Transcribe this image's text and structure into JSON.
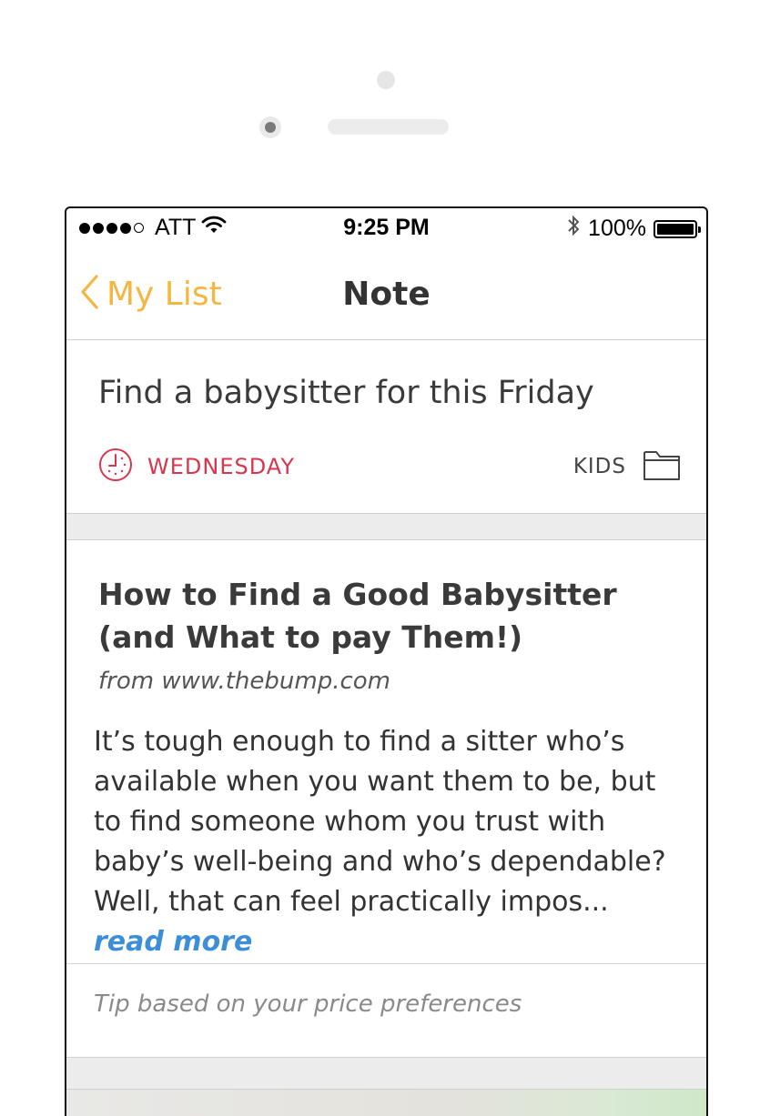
{
  "status_bar": {
    "carrier": "ATT",
    "time": "9:25 PM",
    "battery_percent": "100%",
    "signal_bars_filled": 4,
    "signal_bars_total": 5
  },
  "nav": {
    "back_label": "My List",
    "title": "Note"
  },
  "task": {
    "title": "Find a babysitter for this Friday",
    "due_label": "WEDNESDAY",
    "category_label": "KIDS"
  },
  "article": {
    "title": "How to Find a Good Babysitter (and What to pay Them!)",
    "source": "from www.thebump.com",
    "excerpt": "It’s tough enough to find a sitter who’s available when you want them to be, but to find someone whom you trust with baby’s well-being and who’s dependable? Well, that can feel practically impos... ",
    "read_more": "read more"
  },
  "tip": {
    "text": "Tip based on your price preferences"
  },
  "colors": {
    "accent": "#f5b63f",
    "due": "#d9364c",
    "link": "#3d8ed8"
  }
}
